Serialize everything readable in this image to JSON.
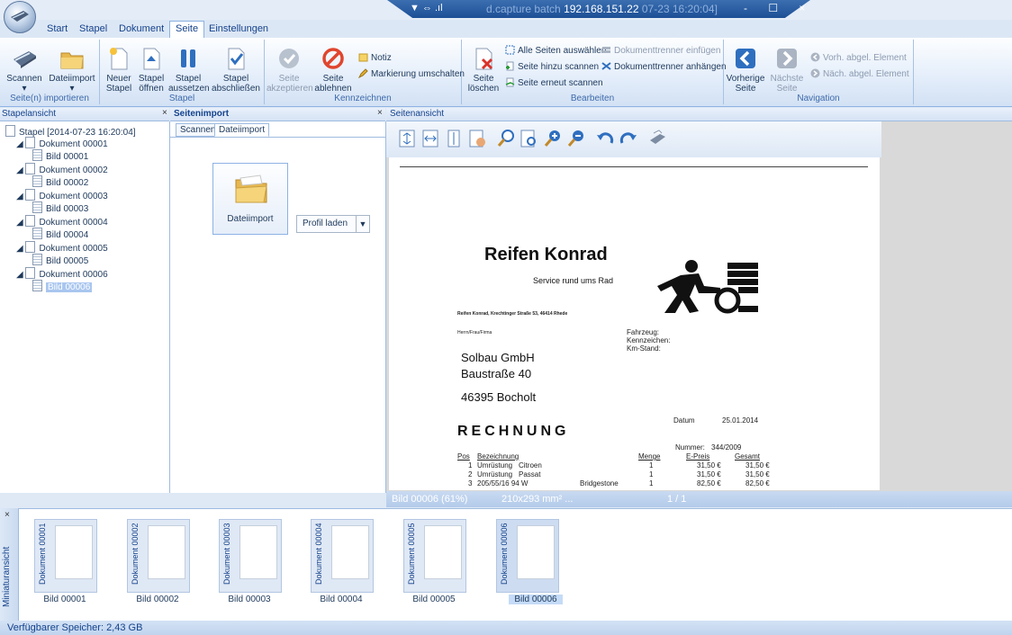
{
  "titlebar": {
    "quick_access": "▼ ⇔ .ıl",
    "app_name": "d.capture batch",
    "host": "192.168.151.22",
    "stamp": "07-23 16:20:04]",
    "window_buttons": "- ☐ ×"
  },
  "menu": {
    "tabs": [
      "Start",
      "Stapel",
      "Dokument",
      "Seite",
      "Einstellungen"
    ],
    "active": "Seite"
  },
  "ribbon": {
    "import": {
      "scan": "Scannen",
      "file_import": "Dateiimport",
      "label": "Seite(n) importieren"
    },
    "stapel": {
      "new_1": "Neuer",
      "new_2": "Stapel",
      "open_1": "Stapel",
      "open_2": "öffnen",
      "suspend_1": "Stapel",
      "suspend_2": "aussetzen",
      "close_1": "Stapel",
      "close_2": "abschließen",
      "label": "Stapel"
    },
    "kennzeichnen": {
      "accept_1": "Seite",
      "accept_2": "akzeptieren",
      "reject_1": "Seite",
      "reject_2": "ablehnen",
      "note": "Notiz",
      "toggle_mark": "Markierung umschalten",
      "label": "Kennzeichnen"
    },
    "bearbeiten": {
      "delete_1": "Seite",
      "delete_2": "löschen",
      "select_all": "Alle Seiten auswählen",
      "add_scan": "Seite hinzu scannen",
      "rescan": "Seite erneut scannen",
      "insert_sep": "Dokumenttrenner einfügen",
      "append_sep": "Dokumenttrenner anhängen",
      "label": "Bearbeiten"
    },
    "navigation": {
      "prev_1": "Vorherige",
      "prev_2": "Seite",
      "next_1": "Nächste",
      "next_2": "Seite",
      "prev_elem": "Vorh. abgel. Element",
      "next_elem": "Näch. abgel. Element",
      "label": "Navigation"
    }
  },
  "panes": {
    "stapelansicht": "Stapelansicht",
    "seitenimport": "Seitenimport",
    "seitenansicht": "Seitenansicht",
    "close": "×"
  },
  "tree": {
    "root": "Stapel [2014-07-23 16:20:04]",
    "documents": [
      {
        "name": "Dokument 00001",
        "page": "Bild 00001"
      },
      {
        "name": "Dokument 00002",
        "page": "Bild 00002"
      },
      {
        "name": "Dokument 00003",
        "page": "Bild 00003"
      },
      {
        "name": "Dokument 00004",
        "page": "Bild 00004"
      },
      {
        "name": "Dokument 00005",
        "page": "Bild 00005"
      },
      {
        "name": "Dokument 00006",
        "page": "Bild 00006"
      }
    ],
    "selected": "Bild 00006"
  },
  "import": {
    "tab_scan": "Scannen",
    "tab_file": "Dateiimport",
    "file_import_label": "Dateiimport",
    "profile_button": "Profil laden"
  },
  "invoice": {
    "company": "Reifen Konrad",
    "slogan": "Service rund ums Rad",
    "sender_line": "Reifen Konrad, Krechtinger Straße 53, 46414 Rhede",
    "salutation": "Herrn/Frau/Firma",
    "vehicle_1": "Fahrzeug:",
    "vehicle_2": "Kennzeichen:",
    "vehicle_3": "Km-Stand:",
    "recipient_1": "Solbau GmbH",
    "recipient_2": "Baustraße 40",
    "recipient_3": "46395 Bocholt",
    "date_label": "Datum",
    "date_value": "25.01.2014",
    "heading": "RECHNUNG",
    "number_label": "Nummer:",
    "number_value": "344/2009",
    "columns": [
      "Pos",
      "Bezeichnung",
      "Menge",
      "E-Preis",
      "Gesamt"
    ],
    "rows": [
      [
        "1",
        "Umrüstung",
        "Citroen",
        "",
        "1",
        "31,50 €",
        "31,50 €"
      ],
      [
        "2",
        "Umrüstung",
        "Passat",
        "",
        "1",
        "31,50 €",
        "31,50 €"
      ],
      [
        "3",
        "205/55/16 94 W",
        "",
        "Bridgestone",
        "1",
        "82,50 €",
        "82,50 €"
      ]
    ]
  },
  "viewer_status": {
    "page": "Bild 00006 (61%)",
    "size": "210x293 mm² ...",
    "count": "1 / 1"
  },
  "thumbs": {
    "side_label": "Miniaturansicht",
    "items": [
      {
        "doc": "Dokument 00001",
        "caption": "Bild 00001"
      },
      {
        "doc": "Dokument 00002",
        "caption": "Bild 00002"
      },
      {
        "doc": "Dokument 00003",
        "caption": "Bild 00003"
      },
      {
        "doc": "Dokument 00004",
        "caption": "Bild 00004"
      },
      {
        "doc": "Dokument 00005",
        "caption": "Bild 00005"
      },
      {
        "doc": "Dokument 00006",
        "caption": "Bild 00006"
      }
    ]
  },
  "statusbar": {
    "memory": "Verfügbarer Speicher: 2,43 GB"
  },
  "colors": {
    "accent": "#1d4f96",
    "ribbon_text": "#15428b",
    "selection": "#a9c6ef"
  }
}
